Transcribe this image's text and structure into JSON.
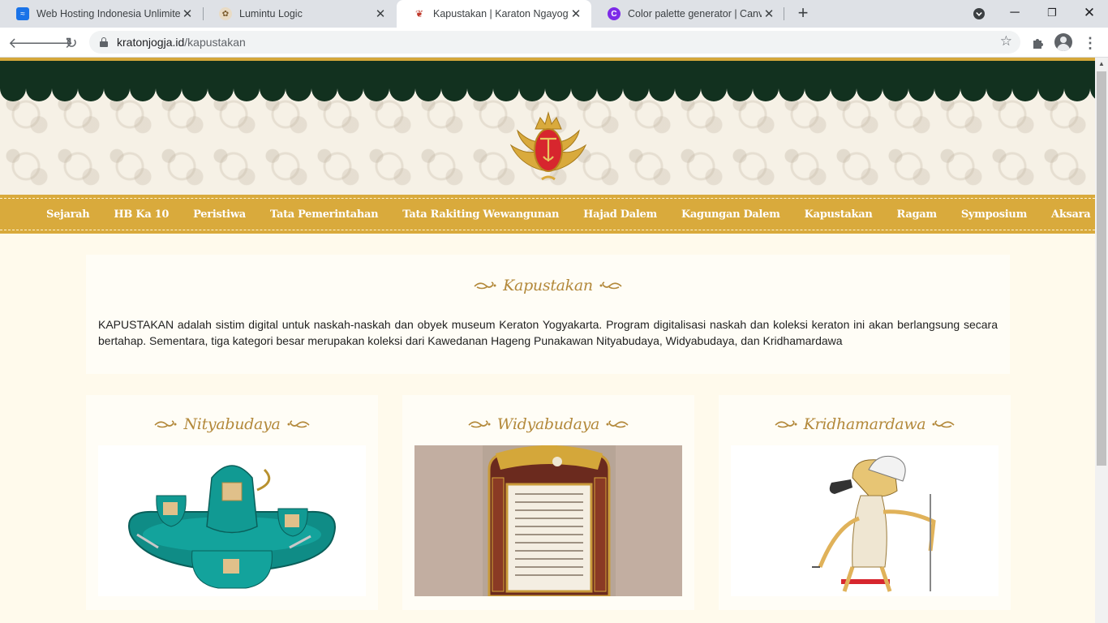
{
  "browser": {
    "tabs": [
      {
        "title": "Web Hosting Indonesia Unlimited",
        "active": false
      },
      {
        "title": "Lumintu Logic",
        "active": false
      },
      {
        "title": "Kapustakan | Karaton Ngayogyakarta",
        "active": true
      },
      {
        "title": "Color palette generator | Canva C",
        "active": false
      }
    ],
    "url_domain": "kratonjogja.id",
    "url_path": "/kapustakan"
  },
  "site": {
    "nav": [
      "Sejarah",
      "HB Ka 10",
      "Peristiwa",
      "Tata Pemerintahan",
      "Tata Rakiting Wewangunan",
      "Hajad Dalem",
      "Kagungan Dalem",
      "Kapustakan",
      "Ragam",
      "Symposium",
      "Aksara"
    ]
  },
  "intro": {
    "title": "Kapustakan",
    "text": "KAPUSTAKAN adalah sistim digital untuk naskah-naskah dan obyek museum Keraton Yogyakarta. Program digitalisasi naskah dan koleksi keraton ini akan berlangsung secara bertahap. Sementara, tiga kategori besar merupakan koleksi dari Kawedanan Hageng Punakawan Nityabudaya, Widyabudaya, dan Kridhamardawa"
  },
  "categories": [
    {
      "title": "Nityabudaya"
    },
    {
      "title": "Widyabudaya"
    },
    {
      "title": "Kridhamardawa"
    }
  ],
  "colors": {
    "gold": "#d9aa3c",
    "green": "#12311f",
    "cream": "#fffaec",
    "heading": "#b3893b"
  }
}
